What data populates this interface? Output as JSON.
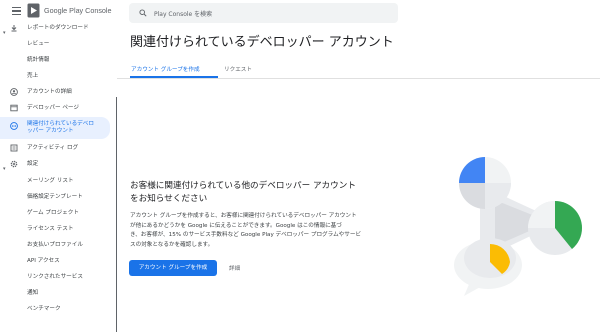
{
  "app": {
    "brand_prefix": "Google Play",
    "brand_suffix": "Console"
  },
  "search": {
    "placeholder": "Play Console を検索"
  },
  "sidebar": {
    "items": [
      {
        "label": "レポートのダウンロード",
        "icon": "download-icon",
        "chevron": "expand-icon"
      },
      {
        "label": "レビュー"
      },
      {
        "label": "統計情報"
      },
      {
        "label": "売上"
      },
      {
        "label": "アカウントの詳細",
        "icon": "account-circle-icon"
      },
      {
        "label": "デベロッパー ページ",
        "icon": "web-page-icon"
      },
      {
        "label_line1": "関連付けられているデベロ",
        "label_line2": "ッパー アカウント",
        "icon": "linked-accounts-icon",
        "active": true
      },
      {
        "label": "アクティビティ ログ",
        "icon": "activity-log-icon"
      },
      {
        "label": "設定",
        "icon": "gear-icon",
        "chevron": "expand-icon"
      },
      {
        "label": "メーリング リスト"
      },
      {
        "label": "価格設定テンプレート"
      },
      {
        "label": "ゲーム プロジェクト"
      },
      {
        "label": "ライセンス テスト"
      },
      {
        "label": "お支払いプロファイル"
      },
      {
        "label": "API アクセス"
      },
      {
        "label": "リンクされたサービス"
      },
      {
        "label": "通知"
      },
      {
        "label": "ベンチマーク"
      }
    ]
  },
  "main": {
    "title": "関連付けられているデベロッパー アカウント",
    "tabs": [
      {
        "label": "アカウント グループを作成",
        "active": true
      },
      {
        "label": "リクエスト",
        "active": false
      }
    ],
    "empty_state": {
      "headline_line1": "お客様に関連付けられている他のデベロッパー アカウント",
      "headline_line2": "をお知らせください",
      "body_line1": "アカウント グループを作成すると、お客様に関連付けられているデベロッパー アカウント",
      "body_line2": "が他にあるかどうかを Google に伝えることができます。Google はこの情報に基づ",
      "body_line3": "き、お客様が、15% のサービス手数料など Google Play デベロッパー プログラムやサービ",
      "body_line4": "スの対象となるかを確認します。",
      "primary_button": "アカウント グループを作成",
      "secondary_link": "詳細"
    }
  },
  "colors": {
    "accent": "#1a73e8",
    "illustration_blue": "#4285f4",
    "illustration_green": "#34a853",
    "illustration_yellow": "#fbbc04",
    "illustration_gray": "#dadce0"
  }
}
